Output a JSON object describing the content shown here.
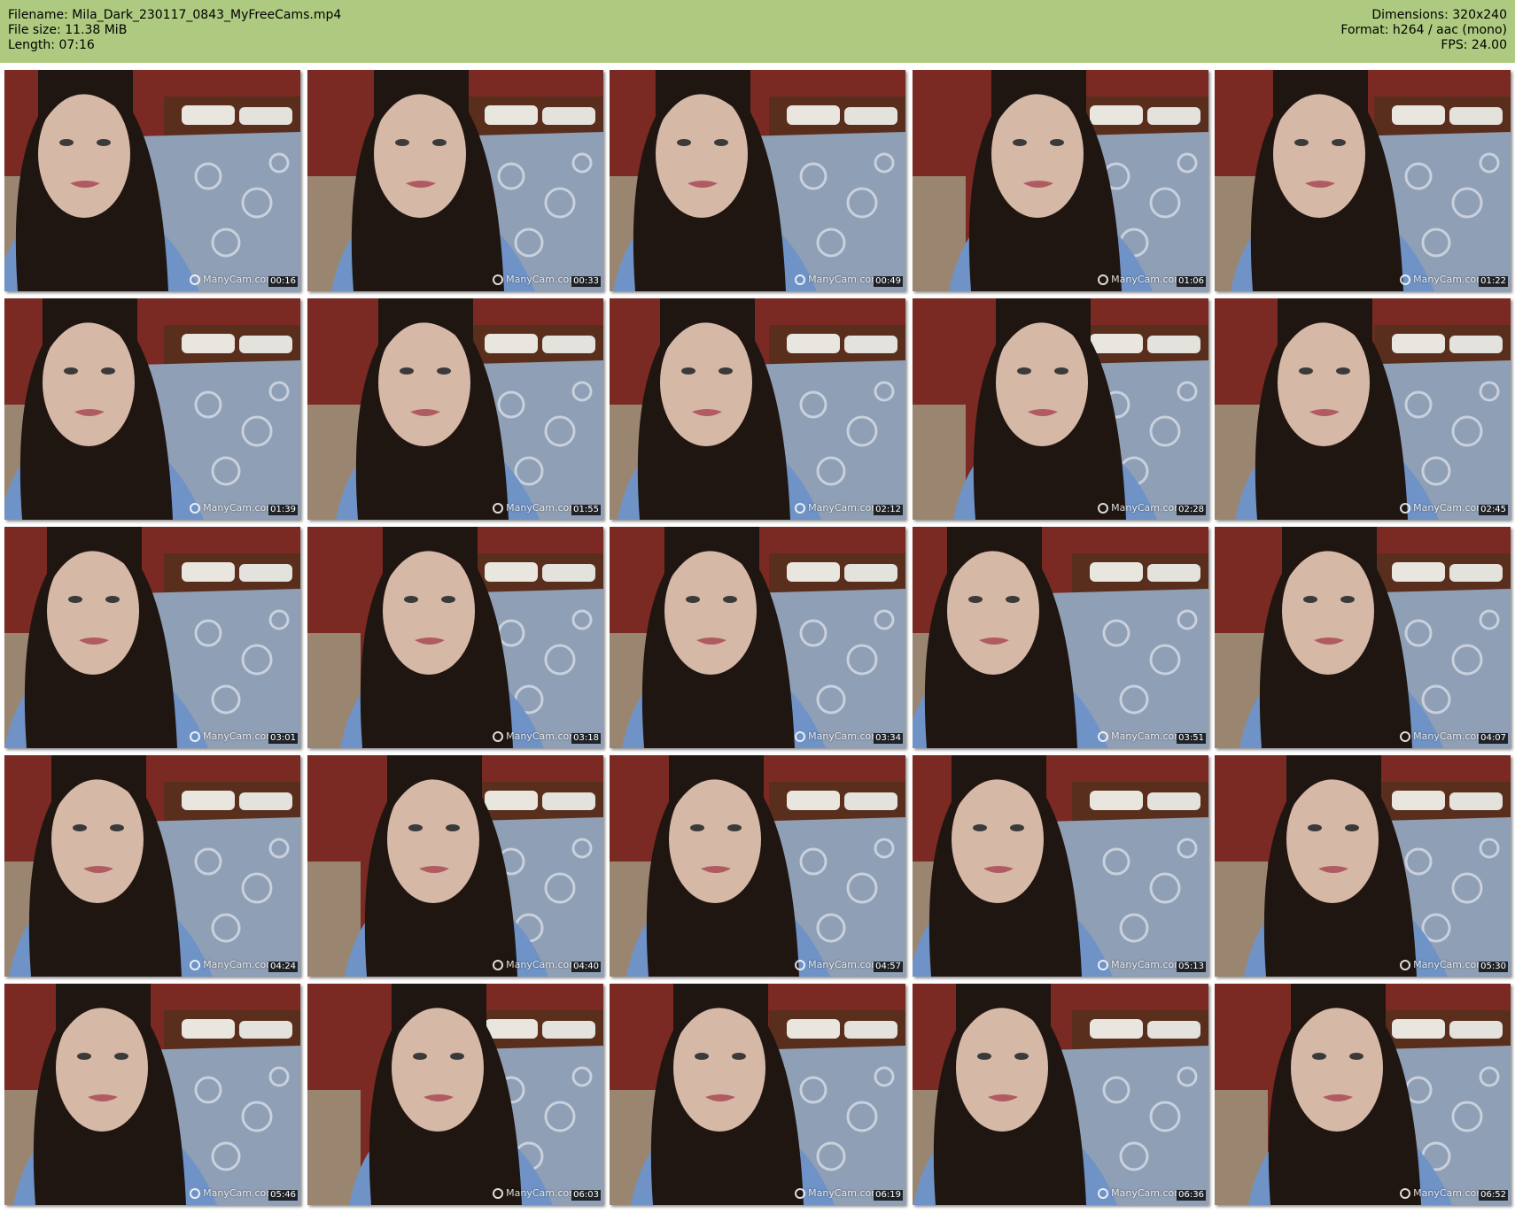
{
  "header": {
    "filename": "Filename: Mila_Dark_230117_0843_MyFreeCams.mp4",
    "filesize": "File size: 11.38 MiB",
    "length": "Length: 07:16",
    "dimensions": "Dimensions: 320x240",
    "format": "Format: h264 / aac (mono)",
    "fps": "FPS: 24.00"
  },
  "watermark": "ManyCam.com",
  "colors": {
    "header_bg": "#aeca80",
    "wall": "#7a2a22",
    "bedding": "#8f9fb5",
    "shirt": "#6f93c6",
    "hair": "#1f1511",
    "skin": "#d6b8a6"
  },
  "frames": [
    {
      "timestamp": "00:16"
    },
    {
      "timestamp": "00:33"
    },
    {
      "timestamp": "00:49"
    },
    {
      "timestamp": "01:06"
    },
    {
      "timestamp": "01:22"
    },
    {
      "timestamp": "01:39"
    },
    {
      "timestamp": "01:55"
    },
    {
      "timestamp": "02:12"
    },
    {
      "timestamp": "02:28"
    },
    {
      "timestamp": "02:45"
    },
    {
      "timestamp": "03:01"
    },
    {
      "timestamp": "03:18"
    },
    {
      "timestamp": "03:34"
    },
    {
      "timestamp": "03:51"
    },
    {
      "timestamp": "04:07"
    },
    {
      "timestamp": "04:24"
    },
    {
      "timestamp": "04:40"
    },
    {
      "timestamp": "04:57"
    },
    {
      "timestamp": "05:13"
    },
    {
      "timestamp": "05:30"
    },
    {
      "timestamp": "05:46"
    },
    {
      "timestamp": "06:03"
    },
    {
      "timestamp": "06:19"
    },
    {
      "timestamp": "06:36"
    },
    {
      "timestamp": "06:52"
    }
  ]
}
